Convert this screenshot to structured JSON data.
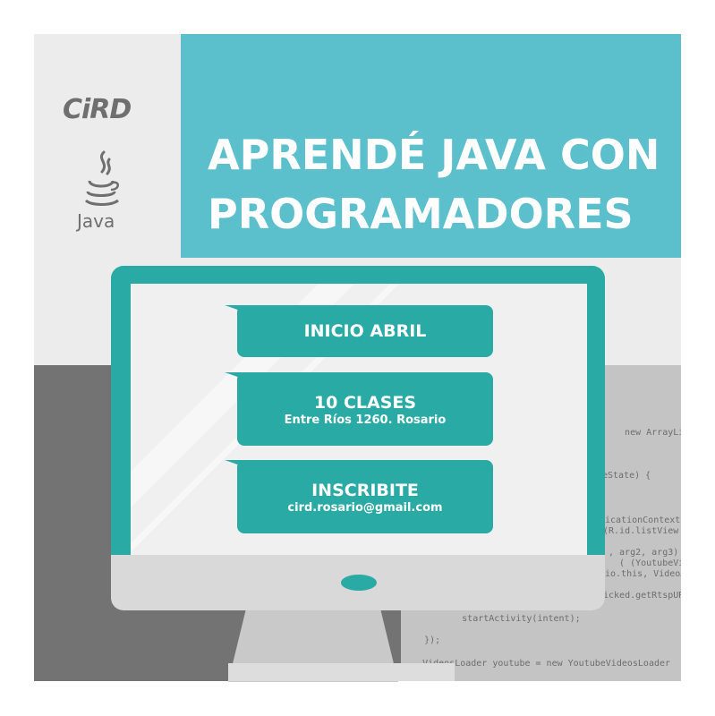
{
  "brand": {
    "logo_text": "CiRD",
    "java_word": "Java"
  },
  "headline": {
    "line1": "APRENDÉ JAVA CON",
    "line2": "PROGRAMADORES"
  },
  "bubbles": [
    {
      "title": "INICIO ABRIL"
    },
    {
      "title": "10 CLASES",
      "subtitle": "Entre Ríos 1260. Rosario"
    },
    {
      "title": "INSCRIBITE",
      "subtitle": "cird.rosario@gmail.com"
    }
  ],
  "code_lines": [
    "   new ArrayList<",
    "eState) {",
    "licationContext",
    "(R.id.listView",
    ", arg2, arg3)",
    "  ( (YoutubeVide",
    "io.this, VideoA",
    "icked.getRtspURL",
    "        startActivity(intent);",
    "    });",
    "    VideosLoader youtube = new YoutubeVideosLoader"
  ],
  "colors": {
    "teal": "#5bbfcc",
    "monitor_teal": "#2aaaa5",
    "light_grey": "#ececec",
    "dark_grey": "#737373",
    "code_grey": "#c4c4c4"
  }
}
